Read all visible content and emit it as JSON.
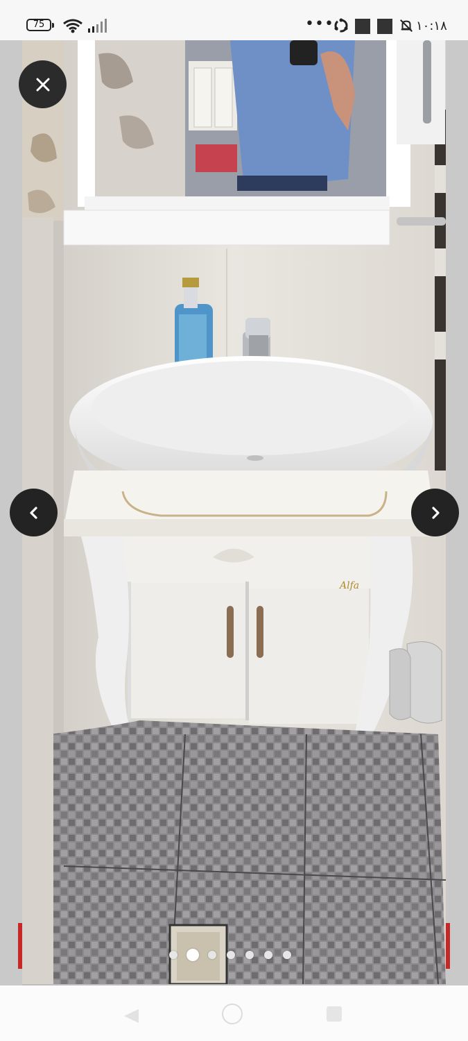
{
  "status_bar": {
    "battery_level": "75",
    "clock": "۱۰:۱۸",
    "icons": [
      "battery-icon",
      "wifi-icon",
      "signal-icon",
      "more-dots-icon",
      "sync-icon",
      "notification-square-icon",
      "notification-square-icon",
      "mute-icon"
    ]
  },
  "viewer": {
    "image_description": "bathroom vanity with vessel sink and mirror cabinet",
    "page_count": 7,
    "active_page": 2,
    "pages": [
      "1",
      "2",
      "3",
      "4",
      "5",
      "6",
      "7"
    ],
    "icons": {
      "close": "close-icon",
      "prev": "chevron-left-icon",
      "next": "chevron-right-icon"
    }
  },
  "nav_bar": {
    "icons": [
      "back-icon",
      "home-icon",
      "recents-icon"
    ]
  },
  "colors": {
    "overlay_button": "#2b2b2b",
    "status_bar_bg": "#f7f7f7",
    "nav_bar_bg": "#fbfbfb",
    "accent_red": "#c62828"
  }
}
